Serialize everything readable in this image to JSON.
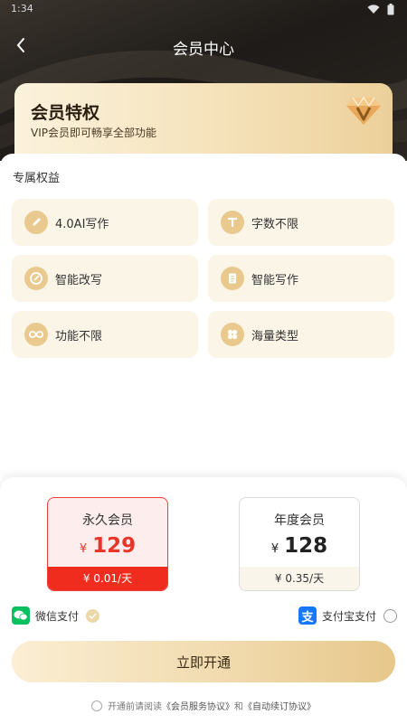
{
  "status_bar": {
    "time": "1:34"
  },
  "header": {
    "title": "会员中心"
  },
  "vip_card": {
    "title": "会员特权",
    "subtitle": "VIP会员即可畅享全部功能"
  },
  "benefits": {
    "section_title": "专属权益",
    "items": [
      {
        "label": "4.0AI写作",
        "icon": "pen-icon"
      },
      {
        "label": "字数不限",
        "icon": "text-t-icon"
      },
      {
        "label": "智能改写",
        "icon": "edit-circle-icon"
      },
      {
        "label": "智能写作",
        "icon": "document-icon"
      },
      {
        "label": "功能不限",
        "icon": "infinity-icon"
      },
      {
        "label": "海量类型",
        "icon": "grid-flower-icon"
      }
    ]
  },
  "plans": [
    {
      "name": "永久会员",
      "currency": "¥",
      "price": "129",
      "per_day": "¥ 0.01/天",
      "selected": true
    },
    {
      "name": "年度会员",
      "currency": "¥",
      "price": "128",
      "per_day": "¥ 0.35/天",
      "selected": false
    }
  ],
  "payment": {
    "wechat": {
      "label": "微信支付",
      "selected": true
    },
    "alipay": {
      "label": "支付宝支付",
      "selected": false
    }
  },
  "cta": {
    "label": "立即开通"
  },
  "agreement": {
    "prefix": "开通前请阅读",
    "service": "《会员服务协议》",
    "and": "和",
    "renewal": "《自动续订协议》"
  },
  "colors": {
    "accent_red": "#f02c1e",
    "gold": "#e9c98e",
    "wechat_green": "#07c160",
    "alipay_blue": "#1677ff"
  }
}
